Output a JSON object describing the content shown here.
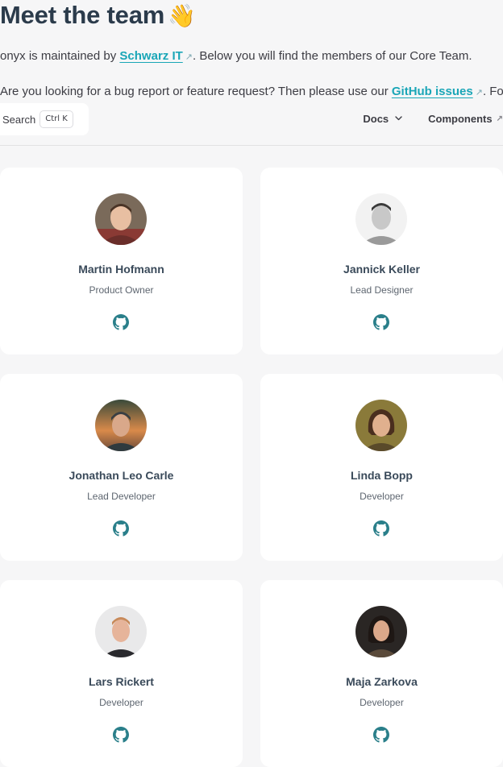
{
  "intro": {
    "title": "Meet the team",
    "title_emoji": "👋",
    "p1_before": "onyx is maintained by ",
    "p1_link": "Schwarz IT",
    "p1_after": ". Below you will find the members of our Core Team.",
    "p2_before": "Are you looking for a bug report or feature request? Then please use our ",
    "p2_link": "GitHub issues",
    "p2_after": ". For"
  },
  "nav": {
    "search_label": "Search",
    "search_shortcut": "Ctrl K",
    "docs_label": "Docs",
    "components_label": "Components"
  },
  "icons": {
    "external": "arrow-up-right-icon",
    "dropdown": "chevron-down-icon",
    "profile": "github-icon"
  },
  "colors": {
    "link": "#1aa6b7",
    "heading": "#2b3b4b",
    "card_background": "#ffffff",
    "page_background": "#f6f6f7"
  },
  "team": [
    {
      "name": "Martin Hofmann",
      "role": "Product Owner"
    },
    {
      "name": "Jannick Keller",
      "role": "Lead Designer"
    },
    {
      "name": "Jonathan Leo Carle",
      "role": "Lead Developer"
    },
    {
      "name": "Linda Bopp",
      "role": "Developer"
    },
    {
      "name": "Lars Rickert",
      "role": "Developer"
    },
    {
      "name": "Maja Zarkova",
      "role": "Developer"
    }
  ]
}
